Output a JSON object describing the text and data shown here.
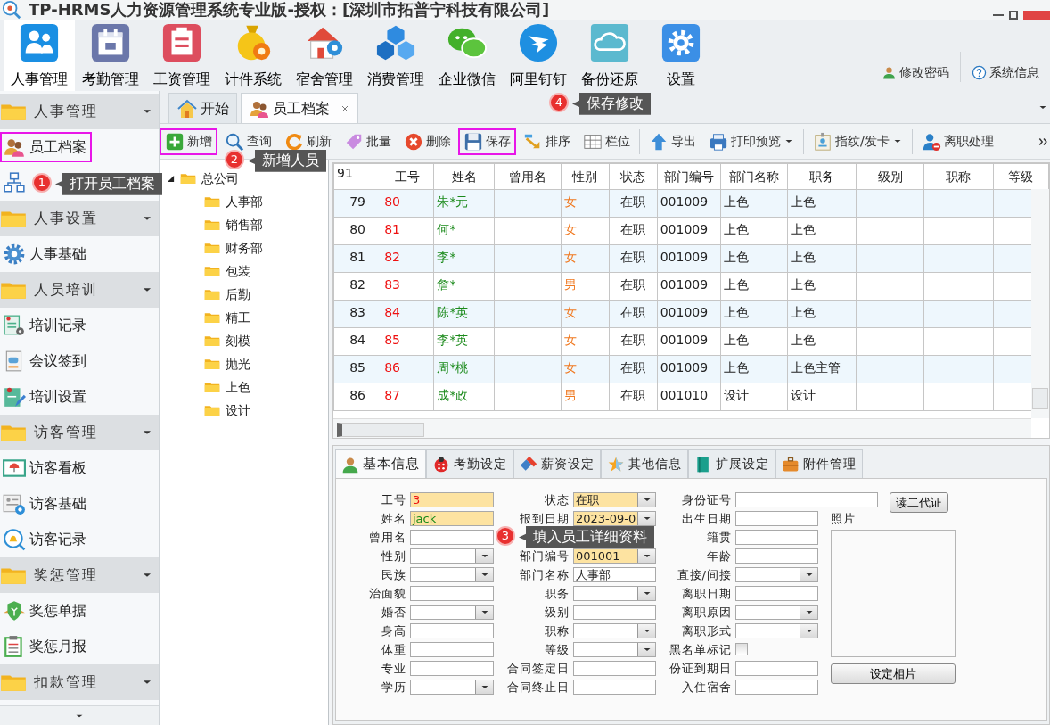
{
  "window": {
    "title": "TP-HRMS人力资源管理系统专业版-授权：[深圳市拓普宁科技有限公司]"
  },
  "modules": [
    {
      "label": "人事管理",
      "kind": "people",
      "selected": true
    },
    {
      "label": "考勤管理",
      "kind": "calendar",
      "selected": false
    },
    {
      "label": "工资管理",
      "kind": "payroll",
      "selected": false
    },
    {
      "label": "计件系统",
      "kind": "bag",
      "selected": false
    },
    {
      "label": "宿舍管理",
      "kind": "house",
      "selected": false
    },
    {
      "label": "消费管理",
      "kind": "cubes",
      "selected": false
    },
    {
      "label": "企业微信",
      "kind": "chat",
      "selected": false
    },
    {
      "label": "阿里钉钉",
      "kind": "wing",
      "selected": false
    },
    {
      "label": "备份还原",
      "kind": "cloud",
      "selected": false
    },
    {
      "label": "设置",
      "kind": "gear",
      "selected": false
    }
  ],
  "account_links": [
    {
      "label": "修改密码",
      "kind": "user"
    },
    {
      "label": "系统信息",
      "kind": "help"
    }
  ],
  "sidebar": [
    {
      "label": "人事管理",
      "items": [
        {
          "label": "员工档案",
          "kind": "staff",
          "highlighted": true
        },
        {
          "kind": "org",
          "highlighted": false
        }
      ]
    },
    {
      "label": "人事设置",
      "items": [
        {
          "label": "人事基础",
          "kind": "cog",
          "highlighted": false
        }
      ]
    },
    {
      "label": "人员培训",
      "items": [
        {
          "label": "培训记录",
          "kind": "cert",
          "highlighted": false
        },
        {
          "label": "会议签到",
          "kind": "doc",
          "highlighted": false
        },
        {
          "label": "培训设置",
          "kind": "certpen",
          "highlighted": false
        }
      ]
    },
    {
      "label": "访客管理",
      "items": [
        {
          "label": "访客看板",
          "kind": "board",
          "highlighted": false
        },
        {
          "label": "访客基础",
          "kind": "card",
          "highlighted": false
        },
        {
          "label": "访客记录",
          "kind": "bell",
          "highlighted": false
        }
      ]
    },
    {
      "label": "奖惩管理",
      "items": [
        {
          "label": "奖惩单据",
          "kind": "shield",
          "highlighted": false
        },
        {
          "label": "奖惩月报",
          "kind": "clipboard",
          "highlighted": false
        }
      ]
    },
    {
      "label": "扣款管理"
    }
  ],
  "tabs": [
    {
      "label": "开始",
      "kind": "home",
      "selected": false,
      "closable": false
    },
    {
      "label": "员工档案",
      "kind": "staff",
      "selected": true,
      "closable": true
    }
  ],
  "toolbar": [
    {
      "label": "新增",
      "kind": "add",
      "highlighted": true,
      "dropdown": false
    },
    {
      "label": "查询",
      "kind": "search",
      "highlighted": false,
      "dropdown": false
    },
    {
      "label": "刷新",
      "kind": "refresh",
      "highlighted": false,
      "dropdown": false
    },
    {
      "label": "批量",
      "kind": "tag",
      "highlighted": false,
      "dropdown": false
    },
    {
      "label": "删除",
      "kind": "delete",
      "highlighted": false,
      "dropdown": false
    },
    {
      "label": "保存",
      "kind": "save",
      "highlighted": true,
      "dropdown": false
    },
    {
      "label": "排序",
      "kind": "sort",
      "highlighted": false,
      "dropdown": false
    },
    {
      "label": "栏位",
      "kind": "columns",
      "highlighted": false,
      "dropdown": false
    },
    {
      "kind": "separator"
    },
    {
      "label": "导出",
      "kind": "export",
      "highlighted": false,
      "dropdown": false
    },
    {
      "label": "打印预览",
      "kind": "print",
      "highlighted": false,
      "dropdown": true
    },
    {
      "kind": "separator"
    },
    {
      "label": "指纹/发卡",
      "kind": "badge",
      "highlighted": false,
      "dropdown": true
    },
    {
      "kind": "separator"
    },
    {
      "label": "离职处理",
      "kind": "leave",
      "highlighted": false,
      "dropdown": false
    }
  ],
  "tree": {
    "label": "总公司",
    "expanded": true,
    "children": [
      {
        "label": "人事部"
      },
      {
        "label": "销售部"
      },
      {
        "label": "财务部"
      },
      {
        "label": "包装"
      },
      {
        "label": "后勤"
      },
      {
        "label": "精工"
      },
      {
        "label": "刻模"
      },
      {
        "label": "抛光"
      },
      {
        "label": "上色"
      },
      {
        "label": "设计"
      }
    ]
  },
  "grid": {
    "corner": "91",
    "columns": [
      "工号",
      "姓名",
      "曾用名",
      "性别",
      "状态",
      "部门编号",
      "部门名称",
      "职务",
      "级别",
      "职称",
      "等级"
    ],
    "rows": [
      {
        "index": "79",
        "id": "80",
        "name": "朱*元",
        "gender": "女",
        "status": "在职",
        "dept_code": "001009",
        "dept_name": "上色",
        "position": "上色"
      },
      {
        "index": "80",
        "id": "81",
        "name": "何*",
        "gender": "女",
        "status": "在职",
        "dept_code": "001009",
        "dept_name": "上色",
        "position": "上色"
      },
      {
        "index": "81",
        "id": "82",
        "name": "李*",
        "gender": "女",
        "status": "在职",
        "dept_code": "001009",
        "dept_name": "上色",
        "position": "上色"
      },
      {
        "index": "82",
        "id": "83",
        "name": "詹*",
        "gender": "男",
        "status": "在职",
        "dept_code": "001009",
        "dept_name": "上色",
        "position": "上色"
      },
      {
        "index": "83",
        "id": "84",
        "name": "陈*英",
        "gender": "女",
        "status": "在职",
        "dept_code": "001009",
        "dept_name": "上色",
        "position": "上色"
      },
      {
        "index": "84",
        "id": "85",
        "name": "李*英",
        "gender": "女",
        "status": "在职",
        "dept_code": "001009",
        "dept_name": "上色",
        "position": "上色"
      },
      {
        "index": "85",
        "id": "86",
        "name": "周*桃",
        "gender": "女",
        "status": "在职",
        "dept_code": "001009",
        "dept_name": "上色",
        "position": "上色主管"
      },
      {
        "index": "86",
        "id": "87",
        "name": "成*政",
        "gender": "男",
        "status": "在职",
        "dept_code": "001010",
        "dept_name": "设计",
        "position": "设计"
      }
    ]
  },
  "detail_tabs": [
    {
      "label": "基本信息",
      "kind": "person",
      "selected": true
    },
    {
      "label": "考勤设定",
      "kind": "bug",
      "selected": false
    },
    {
      "label": "薪资设定",
      "kind": "eraser",
      "selected": false
    },
    {
      "label": "其他信息",
      "kind": "star",
      "selected": false
    },
    {
      "label": "扩展设定",
      "kind": "book",
      "selected": false
    },
    {
      "label": "附件管理",
      "kind": "case",
      "selected": false
    }
  ],
  "form": {
    "columns": [
      [
        {
          "label": "工号",
          "kind": "text",
          "required": true,
          "value": "3"
        },
        {
          "label": "姓名",
          "kind": "text",
          "required": true,
          "value": "jack"
        },
        {
          "label": "曾用名",
          "kind": "text",
          "required": false
        },
        {
          "label": "性别",
          "kind": "select",
          "required": false
        },
        {
          "label": "民族",
          "kind": "select",
          "required": false
        },
        {
          "label": "治面貌",
          "kind": "text",
          "required": false
        },
        {
          "label": "婚否",
          "kind": "select",
          "required": false
        },
        {
          "label": "身高",
          "kind": "text",
          "required": false
        },
        {
          "label": "体重",
          "kind": "text",
          "required": false
        },
        {
          "label": "专业",
          "kind": "text",
          "required": false
        },
        {
          "label": "学历",
          "kind": "select",
          "required": false
        }
      ],
      [
        {
          "label": "状态",
          "kind": "select",
          "required": true,
          "value": "在职"
        },
        {
          "label": "报到日期",
          "kind": "select",
          "required": true,
          "value": "2023-09-0"
        },
        {
          "label": "部门编号",
          "kind": "select",
          "required": true,
          "value": "001001"
        },
        {
          "label": "部门名称",
          "kind": "text",
          "required": false,
          "value": "人事部"
        },
        {
          "label": "职务",
          "kind": "select",
          "required": false
        },
        {
          "label": "级别",
          "kind": "text",
          "required": false
        },
        {
          "label": "职称",
          "kind": "select",
          "required": false
        },
        {
          "label": "等级",
          "kind": "select",
          "required": false
        },
        {
          "label": "合同签定日",
          "kind": "text",
          "required": false
        },
        {
          "label": "合同终止日",
          "kind": "text",
          "required": false
        }
      ],
      [
        {
          "label": "身份证号",
          "kind": "text",
          "required": false,
          "button": "读二代证"
        },
        {
          "label": "出生日期",
          "kind": "text",
          "required": false
        },
        {
          "label": "籍贯",
          "kind": "text",
          "required": false
        },
        {
          "label": "年龄",
          "kind": "text",
          "required": false
        },
        {
          "label": "直接/间接",
          "kind": "select",
          "required": false
        },
        {
          "label": "离职日期",
          "kind": "text",
          "required": false
        },
        {
          "label": "离职原因",
          "kind": "select",
          "required": false
        },
        {
          "label": "离职形式",
          "kind": "select",
          "required": false
        },
        {
          "label": "黑名单标记",
          "kind": "check",
          "checked": false
        },
        {
          "label": "份证到期日",
          "kind": "text",
          "required": false
        },
        {
          "label": "入住宿舍",
          "kind": "text",
          "required": false
        }
      ]
    ],
    "photo": {
      "label": "照片",
      "button": "设定相片"
    }
  },
  "callouts": [
    {
      "number": "4",
      "text": "保存修改"
    },
    {
      "number": "2",
      "text": "新增人员"
    },
    {
      "number": "1",
      "text": "打开员工档案"
    },
    {
      "number": "3",
      "text": "填入员工详细资料"
    }
  ]
}
